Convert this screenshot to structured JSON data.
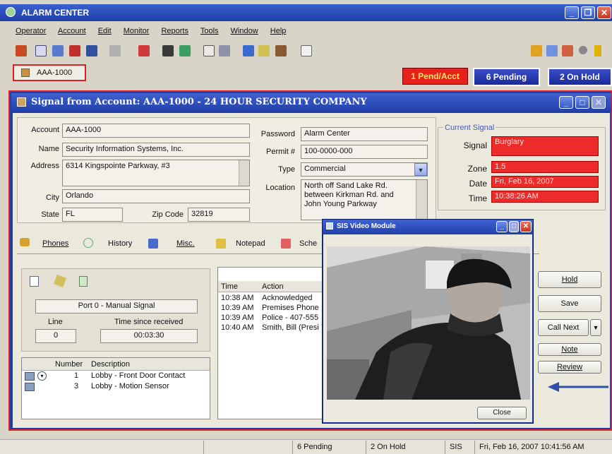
{
  "app": {
    "title": "ALARM CENTER"
  },
  "menu": [
    "Operator",
    "Account",
    "Edit",
    "Monitor",
    "Reports",
    "Tools",
    "Window",
    "Help"
  ],
  "account_tab": {
    "label": "AAA-1000"
  },
  "queue": {
    "pend_acct": "1 Pend/Acct",
    "pending": "6 Pending",
    "on_hold": "2 On Hold"
  },
  "signal_window": {
    "title": "Signal from Account: AAA-1000  -  24 HOUR SECURITY COMPANY"
  },
  "account_form": {
    "account_label": "Account",
    "account_value": "AAA-1000",
    "name_label": "Name",
    "name_value": "Security Information Systems, Inc.",
    "address_label": "Address",
    "address_value": "6314 Kingspointe Parkway, #3",
    "city_label": "City",
    "city_value": "Orlando",
    "state_label": "State",
    "state_value": "FL",
    "zip_label": "Zip Code",
    "zip_value": "32819",
    "password_label": "Password",
    "password_value": "Alarm Center",
    "permit_label": "Permit #",
    "permit_value": "100-0000-000",
    "type_label": "Type",
    "type_value": "Commercial",
    "location_label": "Location",
    "location_lines": [
      "North off Sand Lake Rd.",
      "between Kirkman Rd. and",
      "John Young Parkway"
    ]
  },
  "current_signal": {
    "heading": "Current Signal",
    "signal_label": "Signal",
    "signal_value": "Burglary",
    "zone_label": "Zone",
    "zone_value": "1.5",
    "date_label": "Date",
    "date_value": "Fri, Feb 16, 2007",
    "time_label": "Time",
    "time_value": "10:38:26 AM"
  },
  "tabs": [
    "Phones",
    "History",
    "Misc.",
    "Notepad",
    "Sche"
  ],
  "port_panel": {
    "port_value": "Port 0 - Manual Signal",
    "line_label": "Line",
    "line_value": "0",
    "time_label": "Time since received",
    "time_value": "00:03:30"
  },
  "zones_table": {
    "headers": [
      "Number",
      "Description"
    ],
    "rows": [
      {
        "number": "1",
        "description": "Lobby - Front Door Contact"
      },
      {
        "number": "3",
        "description": "Lobby - Motion Sensor"
      }
    ]
  },
  "history_table": {
    "headers": [
      "Time",
      "Action"
    ],
    "rows": [
      {
        "time": "10:38 AM",
        "action": "Acknowledged"
      },
      {
        "time": "10:39 AM",
        "action": "Premises Phone"
      },
      {
        "time": "10:39 AM",
        "action": "Police - 407-555"
      },
      {
        "time": "10:40 AM",
        "action": "Smith, Bill (Presi"
      }
    ]
  },
  "actions": {
    "hold": "Hold",
    "save": "Save",
    "call_next": "Call Next",
    "note": "Note",
    "review": "Review"
  },
  "video_module": {
    "title": "SIS Video Module",
    "close_label": "Close"
  },
  "statusbar": {
    "pending": "6 Pending",
    "on_hold": "2 On Hold",
    "user": "SIS",
    "datetime": "Fri, Feb 16, 2007  10:41:56 AM"
  }
}
